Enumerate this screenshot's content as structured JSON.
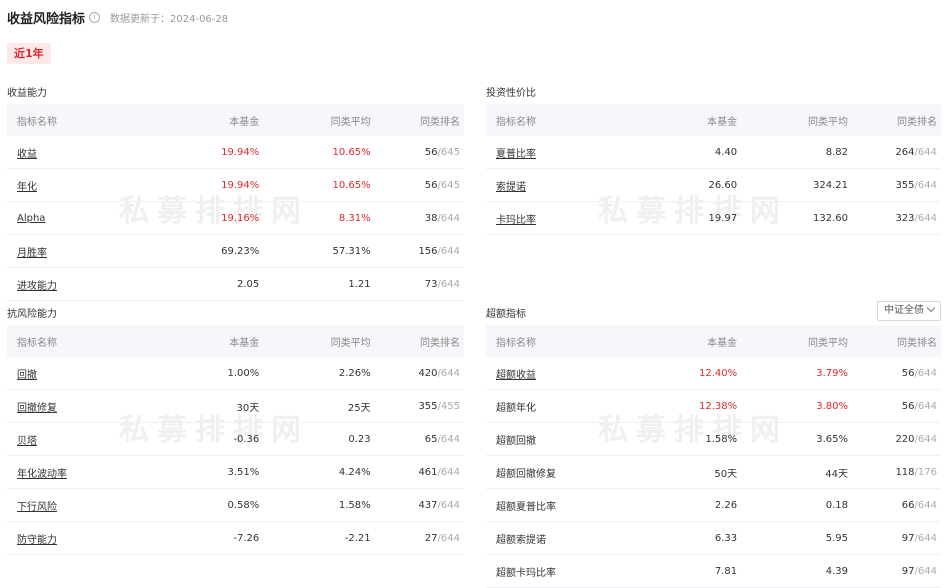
{
  "header": {
    "title": "收益风险指标",
    "info_icon": "info-circle-icon",
    "update_text": "数据更新于：2024-06-28"
  },
  "period_tag": "近1年",
  "watermark_text": "私募排排网",
  "columns": [
    "指标名称",
    "本基金",
    "同类平均",
    "同类排名"
  ],
  "panels": {
    "returns": {
      "title": "收益能力",
      "rows": [
        {
          "name": "收益",
          "fund": "19.94%",
          "avg": "10.65%",
          "rank": "56",
          "total": "645",
          "link": true,
          "red": true
        },
        {
          "name": "年化",
          "fund": "19.94%",
          "avg": "10.65%",
          "rank": "56",
          "total": "645",
          "link": true,
          "red": true
        },
        {
          "name": "Alpha",
          "fund": "19.16%",
          "avg": "8.31%",
          "rank": "38",
          "total": "644",
          "link": true,
          "red": true
        },
        {
          "name": "月胜率",
          "fund": "69.23%",
          "avg": "57.31%",
          "rank": "156",
          "total": "644",
          "link": true,
          "red": false
        },
        {
          "name": "进攻能力",
          "fund": "2.05",
          "avg": "1.21",
          "rank": "73",
          "total": "644",
          "link": true,
          "red": false
        }
      ]
    },
    "value": {
      "title": "投资性价比",
      "rows": [
        {
          "name": "夏普比率",
          "fund": "4.40",
          "avg": "8.82",
          "rank": "264",
          "total": "644",
          "link": true,
          "red": false
        },
        {
          "name": "索提诺",
          "fund": "26.60",
          "avg": "324.21",
          "rank": "355",
          "total": "644",
          "link": true,
          "red": false
        },
        {
          "name": "卡玛比率",
          "fund": "19.97",
          "avg": "132.60",
          "rank": "323",
          "total": "644",
          "link": true,
          "red": false
        }
      ]
    },
    "risk": {
      "title": "抗风险能力",
      "rows": [
        {
          "name": "回撤",
          "fund": "1.00%",
          "avg": "2.26%",
          "rank": "420",
          "total": "644",
          "link": true,
          "red": false
        },
        {
          "name": "回撤修复",
          "fund": "30天",
          "avg": "25天",
          "rank": "355",
          "total": "455",
          "link": true,
          "red": false
        },
        {
          "name": "贝塔",
          "fund": "-0.36",
          "avg": "0.23",
          "rank": "65",
          "total": "644",
          "link": true,
          "red": false
        },
        {
          "name": "年化波动率",
          "fund": "3.51%",
          "avg": "4.24%",
          "rank": "461",
          "total": "644",
          "link": true,
          "red": false
        },
        {
          "name": "下行风险",
          "fund": "0.58%",
          "avg": "1.58%",
          "rank": "437",
          "total": "644",
          "link": true,
          "red": false
        },
        {
          "name": "防守能力",
          "fund": "-7.26",
          "avg": "-2.21",
          "rank": "27",
          "total": "644",
          "link": true,
          "red": false
        }
      ]
    },
    "excess": {
      "title": "超额指标",
      "select_value": "中证全债",
      "rows": [
        {
          "name": "超额收益",
          "fund": "12.40%",
          "avg": "3.79%",
          "rank": "56",
          "total": "644",
          "link": true,
          "red": true
        },
        {
          "name": "超额年化",
          "fund": "12.38%",
          "avg": "3.80%",
          "rank": "56",
          "total": "644",
          "link": false,
          "red": true
        },
        {
          "name": "超额回撤",
          "fund": "1.58%",
          "avg": "3.65%",
          "rank": "220",
          "total": "644",
          "link": false,
          "red": false
        },
        {
          "name": "超额回撤修复",
          "fund": "50天",
          "avg": "44天",
          "rank": "118",
          "total": "176",
          "link": false,
          "red": false
        },
        {
          "name": "超额夏普比率",
          "fund": "2.26",
          "avg": "0.18",
          "rank": "66",
          "total": "644",
          "link": false,
          "red": false
        },
        {
          "name": "超额索提诺",
          "fund": "6.33",
          "avg": "5.95",
          "rank": "97",
          "total": "644",
          "link": false,
          "red": false
        },
        {
          "name": "超额卡玛比率",
          "fund": "7.81",
          "avg": "4.39",
          "rank": "97",
          "total": "644",
          "link": false,
          "red": false
        }
      ]
    }
  },
  "colors": {
    "accent_red": "#e0292f",
    "tag_bg": "#fde9e9",
    "header_bg": "#f5f7fa"
  }
}
